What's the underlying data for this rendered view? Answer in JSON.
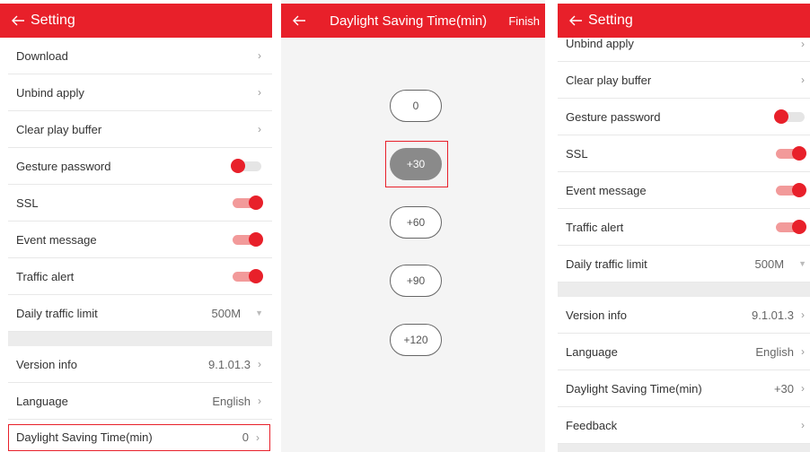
{
  "panel1": {
    "title": "Setting",
    "rows": [
      {
        "label": "Download",
        "kind": "chevron"
      },
      {
        "label": "Unbind apply",
        "kind": "chevron"
      },
      {
        "label": "Clear play buffer",
        "kind": "chevron"
      },
      {
        "label": "Gesture password",
        "kind": "toggle",
        "on": false
      },
      {
        "label": "SSL",
        "kind": "toggle",
        "on": true
      },
      {
        "label": "Event message",
        "kind": "toggle",
        "on": true
      },
      {
        "label": "Traffic alert",
        "kind": "toggle",
        "on": true
      },
      {
        "label": "Daily traffic limit",
        "kind": "select",
        "value": "500M"
      }
    ],
    "rows2": [
      {
        "label": "Version info",
        "value": "9.1.01.3"
      },
      {
        "label": "Language",
        "value": "English"
      },
      {
        "label": "Daylight Saving Time(min)",
        "value": "0"
      }
    ]
  },
  "panel2": {
    "title": "Daylight Saving Time(min)",
    "finish": "Finish",
    "options": [
      "0",
      "+30",
      "+60",
      "+90",
      "+120"
    ],
    "selected": "+30"
  },
  "panel3": {
    "title": "Setting",
    "rows": [
      {
        "label": "Unbind apply",
        "kind": "chevron"
      },
      {
        "label": "Clear play buffer",
        "kind": "chevron"
      },
      {
        "label": "Gesture password",
        "kind": "toggle",
        "on": false
      },
      {
        "label": "SSL",
        "kind": "toggle",
        "on": true
      },
      {
        "label": "Event message",
        "kind": "toggle",
        "on": true
      },
      {
        "label": "Traffic alert",
        "kind": "toggle",
        "on": true
      },
      {
        "label": "Daily traffic limit",
        "kind": "select",
        "value": "500M"
      }
    ],
    "rows2": [
      {
        "label": "Version info",
        "value": "9.1.01.3"
      },
      {
        "label": "Language",
        "value": "English"
      },
      {
        "label": "Daylight Saving Time(min)",
        "value": "+30"
      },
      {
        "label": "Feedback",
        "value": ""
      }
    ]
  },
  "colors": {
    "accent": "#e8202a",
    "selected_pill": "#8a8a8a"
  }
}
